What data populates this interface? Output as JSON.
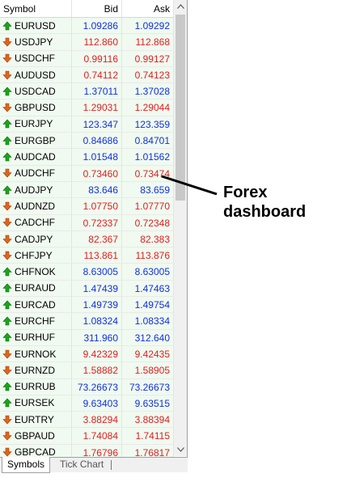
{
  "header": {
    "symbol": "Symbol",
    "bid": "Bid",
    "ask": "Ask"
  },
  "rows": [
    {
      "symbol": "EURUSD",
      "bid": "1.09286",
      "ask": "1.09292",
      "dir": "up"
    },
    {
      "symbol": "USDJPY",
      "bid": "112.860",
      "ask": "112.868",
      "dir": "down"
    },
    {
      "symbol": "USDCHF",
      "bid": "0.99116",
      "ask": "0.99127",
      "dir": "down"
    },
    {
      "symbol": "AUDUSD",
      "bid": "0.74112",
      "ask": "0.74123",
      "dir": "down"
    },
    {
      "symbol": "USDCAD",
      "bid": "1.37011",
      "ask": "1.37028",
      "dir": "up"
    },
    {
      "symbol": "GBPUSD",
      "bid": "1.29031",
      "ask": "1.29044",
      "dir": "down"
    },
    {
      "symbol": "EURJPY",
      "bid": "123.347",
      "ask": "123.359",
      "dir": "up"
    },
    {
      "symbol": "EURGBP",
      "bid": "0.84686",
      "ask": "0.84701",
      "dir": "up"
    },
    {
      "symbol": "AUDCAD",
      "bid": "1.01548",
      "ask": "1.01562",
      "dir": "up"
    },
    {
      "symbol": "AUDCHF",
      "bid": "0.73460",
      "ask": "0.73474",
      "dir": "down"
    },
    {
      "symbol": "AUDJPY",
      "bid": "83.646",
      "ask": "83.659",
      "dir": "up"
    },
    {
      "symbol": "AUDNZD",
      "bid": "1.07750",
      "ask": "1.07770",
      "dir": "down"
    },
    {
      "symbol": "CADCHF",
      "bid": "0.72337",
      "ask": "0.72348",
      "dir": "down"
    },
    {
      "symbol": "CADJPY",
      "bid": "82.367",
      "ask": "82.383",
      "dir": "down"
    },
    {
      "symbol": "CHFJPY",
      "bid": "113.861",
      "ask": "113.876",
      "dir": "down"
    },
    {
      "symbol": "CHFNOK",
      "bid": "8.63005",
      "ask": "8.63005",
      "dir": "up"
    },
    {
      "symbol": "EURAUD",
      "bid": "1.47439",
      "ask": "1.47463",
      "dir": "up"
    },
    {
      "symbol": "EURCAD",
      "bid": "1.49739",
      "ask": "1.49754",
      "dir": "up"
    },
    {
      "symbol": "EURCHF",
      "bid": "1.08324",
      "ask": "1.08334",
      "dir": "up"
    },
    {
      "symbol": "EURHUF",
      "bid": "311.960",
      "ask": "312.640",
      "dir": "up"
    },
    {
      "symbol": "EURNOK",
      "bid": "9.42329",
      "ask": "9.42435",
      "dir": "down"
    },
    {
      "symbol": "EURNZD",
      "bid": "1.58882",
      "ask": "1.58905",
      "dir": "down"
    },
    {
      "symbol": "EURRUB",
      "bid": "73.26673",
      "ask": "73.26673",
      "dir": "up"
    },
    {
      "symbol": "EURSEK",
      "bid": "9.63403",
      "ask": "9.63515",
      "dir": "up"
    },
    {
      "symbol": "EURTRY",
      "bid": "3.88294",
      "ask": "3.88394",
      "dir": "down"
    },
    {
      "symbol": "GBPAUD",
      "bid": "1.74084",
      "ask": "1.74115",
      "dir": "down"
    },
    {
      "symbol": "GBPCAD",
      "bid": "1.76796",
      "ask": "1.76817",
      "dir": "down"
    }
  ],
  "tabs": {
    "symbols": "Symbols",
    "tick_chart": "Tick Chart"
  },
  "callout": {
    "line1": "Forex",
    "line2": "dashboard"
  },
  "colors": {
    "up_arrow": "#1aa51a",
    "down_arrow": "#e0651a",
    "bid_up": "#1030e0",
    "bid_down": "#e02020"
  }
}
